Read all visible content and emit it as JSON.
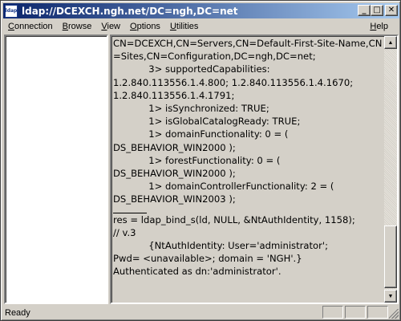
{
  "window": {
    "title": "ldap://DCEXCH.ngh.net/DC=ngh,DC=net",
    "icon_text": "ldap"
  },
  "title_buttons": {
    "minimize": "_",
    "maximize": "□",
    "close": "✕"
  },
  "menu": [
    {
      "underline": "C",
      "rest": "onnection"
    },
    {
      "underline": "B",
      "rest": "rowse"
    },
    {
      "underline": "V",
      "rest": "iew"
    },
    {
      "underline": "O",
      "rest": "ptions"
    },
    {
      "underline": "U",
      "rest": "tilities"
    }
  ],
  "help_menu": {
    "underline": "H",
    "rest": "elp"
  },
  "output_lines_top": [
    "CN=DCEXCH,CN=Servers,CN=Default-First-Site-Name,CN=Sites,CN=Configuration,DC=ngh,DC=net;",
    "            3> supportedCapabilities:",
    "1.2.840.113556.1.4.800; 1.2.840.113556.1.4.1670;",
    "1.2.840.113556.1.4.1791;",
    "            1> isSynchronized: TRUE;",
    "            1> isGlobalCatalogReady: TRUE;",
    "            1> domainFunctionality: 0 = (",
    "DS_BEHAVIOR_WIN2000 );",
    "            1> forestFunctionality: 0 = (",
    "DS_BEHAVIOR_WIN2000 );",
    "            1> domainControllerFunctionality: 2 = (",
    "DS_BEHAVIOR_WIN2003 );"
  ],
  "output_lines_bottom": [
    "res = ldap_bind_s(ld, NULL, &NtAuthIdentity, 1158);",
    "// v.3",
    "            {NtAuthIdentity: User='administrator';",
    "Pwd= <unavailable>; domain = 'NGH'.}",
    "Authenticated as dn:'administrator'."
  ],
  "status": {
    "text": "Ready"
  }
}
